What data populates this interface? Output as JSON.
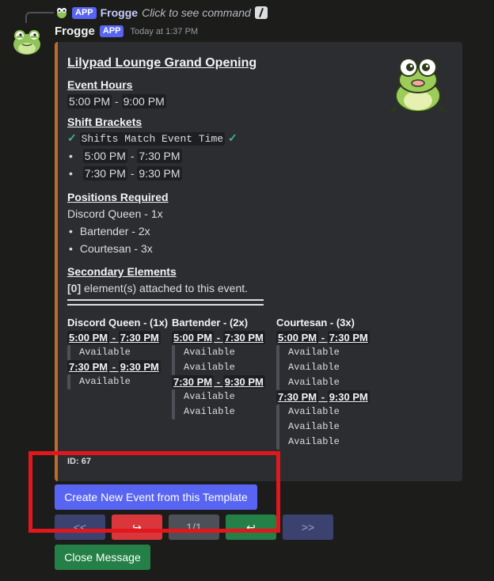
{
  "reply": {
    "app_badge": "APP",
    "author": "Frogge",
    "text": "Click to see command",
    "cmd_icon": "slash-command-icon"
  },
  "message": {
    "author": "Frogge",
    "app_badge": "APP",
    "timestamp": "Today at 1:37 PM",
    "avatar_icon": "frog-avatar"
  },
  "embed": {
    "accent_color": "#c06a2b",
    "title": "Lilypad Lounge Grand Opening",
    "thumbnail": "frog-mascot",
    "event_hours": {
      "heading": "Event Hours",
      "start": "5:00 PM",
      "sep": "-",
      "end": "9:00 PM"
    },
    "shift_brackets": {
      "heading": "Shifts Brackets",
      "heading_text": "Shift Brackets",
      "match_text": "Shifts Match Event Time",
      "items": [
        {
          "start": "5:00 PM",
          "sep": "-",
          "end": "7:30 PM"
        },
        {
          "start": "7:30 PM",
          "sep": "-",
          "end": "9:30 PM"
        }
      ]
    },
    "positions": {
      "heading": "Positions Required",
      "lead": "Discord Queen - 1x",
      "items": [
        "Bartender - 2x",
        "Courtesan - 3x"
      ]
    },
    "secondary": {
      "heading": "Secondary Elements",
      "count": "[0]",
      "text": "element(s) attached to this event."
    },
    "columns": [
      {
        "title": "Discord Queen - (1x)",
        "slots": [
          {
            "start": "5:00 PM",
            "sep": " - ",
            "end": "7:30 PM",
            "entries": [
              "Available"
            ]
          },
          {
            "start": "7:30 PM",
            "sep": " - ",
            "end": "9:30 PM",
            "entries": [
              "Available"
            ]
          }
        ]
      },
      {
        "title": "Bartender - (2x)",
        "slots": [
          {
            "start": "5:00 PM",
            "sep": " - ",
            "end": "7:30 PM",
            "entries": [
              "Available",
              "Available"
            ]
          },
          {
            "start": "7:30 PM",
            "sep": " - ",
            "end": "9:30 PM",
            "entries": [
              "Available",
              "Available"
            ]
          }
        ]
      },
      {
        "title": "Courtesan - (3x)",
        "slots": [
          {
            "start": "5:00 PM",
            "sep": " - ",
            "end": "7:30 PM",
            "entries": [
              "Available",
              "Available",
              "Available"
            ]
          },
          {
            "start": "7:30 PM",
            "sep": " - ",
            "end": "9:30 PM",
            "entries": [
              "Available",
              "Available",
              "Available"
            ]
          }
        ]
      }
    ],
    "id_text": "ID: 67"
  },
  "buttons": {
    "create_template": "Create New Event from this Template",
    "first": "<<",
    "back": "↪",
    "page": "1/1",
    "enter": "↩",
    "last": ">>",
    "close": "Close Message"
  },
  "colors": {
    "background": "#1c1d1a",
    "embed_bg": "#2b2d31",
    "blurple": "#5865f2",
    "red": "#da373c",
    "green": "#248046",
    "annotation_red": "#e3161e"
  }
}
